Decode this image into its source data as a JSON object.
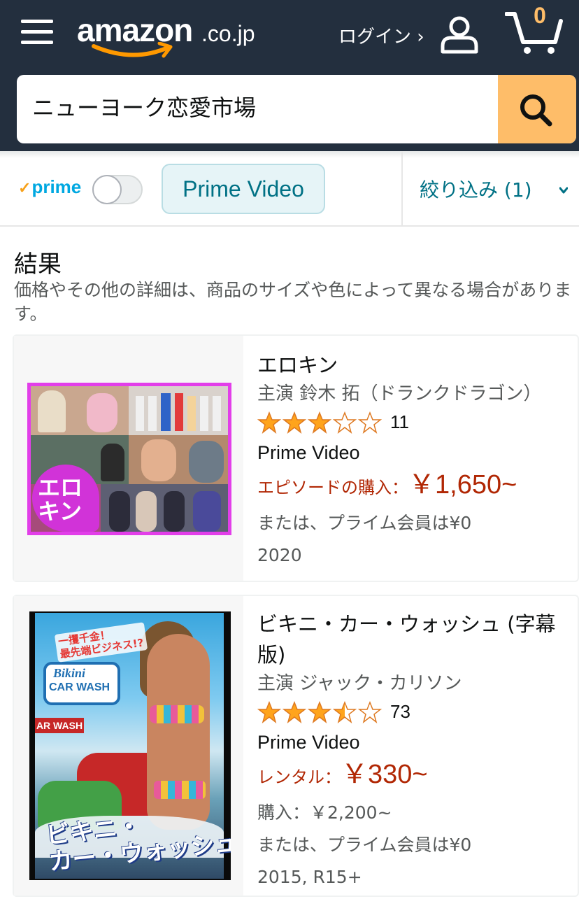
{
  "header": {
    "logo_main": "amazon",
    "logo_tld": ".co.jp",
    "login_label": "ログイン ›",
    "cart_count": "0",
    "colors": {
      "bar": "#232f3e",
      "search_button": "#febd69",
      "accent": "#ff9900"
    }
  },
  "search": {
    "value": "ニューヨーク恋愛市場"
  },
  "filters": {
    "prime_label": "prime",
    "prime_check": "✓",
    "prime_toggle_on": false,
    "chip_label": "Prime Video",
    "refine_label": "絞り込み (1)"
  },
  "results": {
    "heading": "結果",
    "note": "価格やその他の詳細は、商品のサイズや色によって異なる場合があります。"
  },
  "products": [
    {
      "title": "エロキン",
      "starring": "主演 鈴木 拓（ドランクドラゴン）",
      "rating": 3,
      "rating_count": "11",
      "format": "Prime Video",
      "price_label": "エピソードの購入：",
      "price": "￥1,650~",
      "extra": "または、プライム会員は¥0",
      "year": "2020",
      "thumb_badge": "エロ\nキン"
    },
    {
      "title": "ビキニ・カー・ウォッシュ (字幕版)",
      "starring": "主演 ジャック・カリソン",
      "rating": 3.5,
      "rating_count": "73",
      "format": "Prime Video",
      "price_label": "レンタル：",
      "price": "￥330~",
      "buy": "購入：￥2,200~",
      "extra": "または、プライム会員は¥0",
      "year": "2015, R15+",
      "thumb_sign_1": "Bikini",
      "thumb_sign_2": "CAR WASH",
      "thumb_wash": "AR WASH",
      "thumb_tag": "一攫千金！\n最先端ビジネス!?",
      "thumb_title": "ビキニ・\nカー・ウォッシュ"
    }
  ]
}
